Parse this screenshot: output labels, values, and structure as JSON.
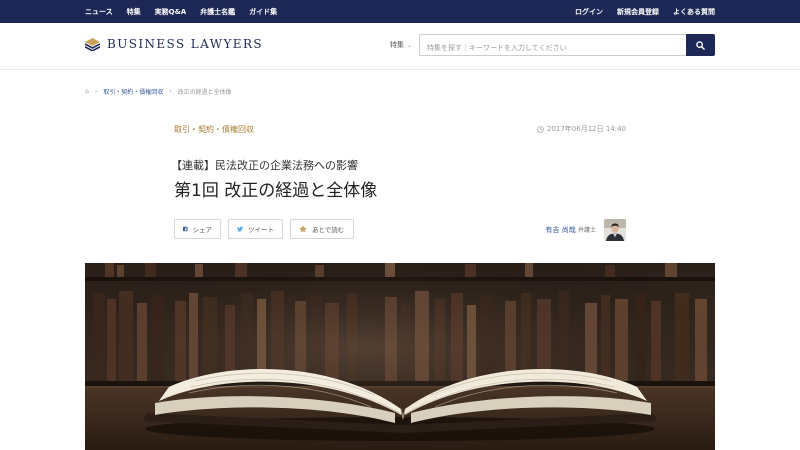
{
  "topnav": {
    "left": [
      "ニュース",
      "特集",
      "実務Q&A",
      "弁護士名鑑",
      "ガイド集"
    ],
    "right": [
      "ログイン",
      "新規会員登録",
      "よくある質問"
    ]
  },
  "header": {
    "logo_text": "BUSINESS LAWYERS",
    "feature_label": "特集",
    "search_placeholder": "特集を探す｜キーワードを入力してください"
  },
  "breadcrumb": {
    "home": "⌂",
    "sep": "›",
    "category": "取引・契約・債権回収",
    "current": "改正の経過と全体像"
  },
  "article": {
    "category": "取引・契約・債権回収",
    "date": "2017年06月12日 14:40",
    "series": "【連載】民法改正の企業法務への影響",
    "title": "第1回 改正の経過と全体像"
  },
  "share": {
    "facebook": "シェア",
    "twitter": "ツイート",
    "read_later": "あとで読む"
  },
  "author": {
    "name": "有吉 尚哉",
    "suffix": "弁護士"
  },
  "colors": {
    "navy": "#1d2856",
    "accent_gold": "#a57a30",
    "link_blue": "#3a5a9a"
  }
}
